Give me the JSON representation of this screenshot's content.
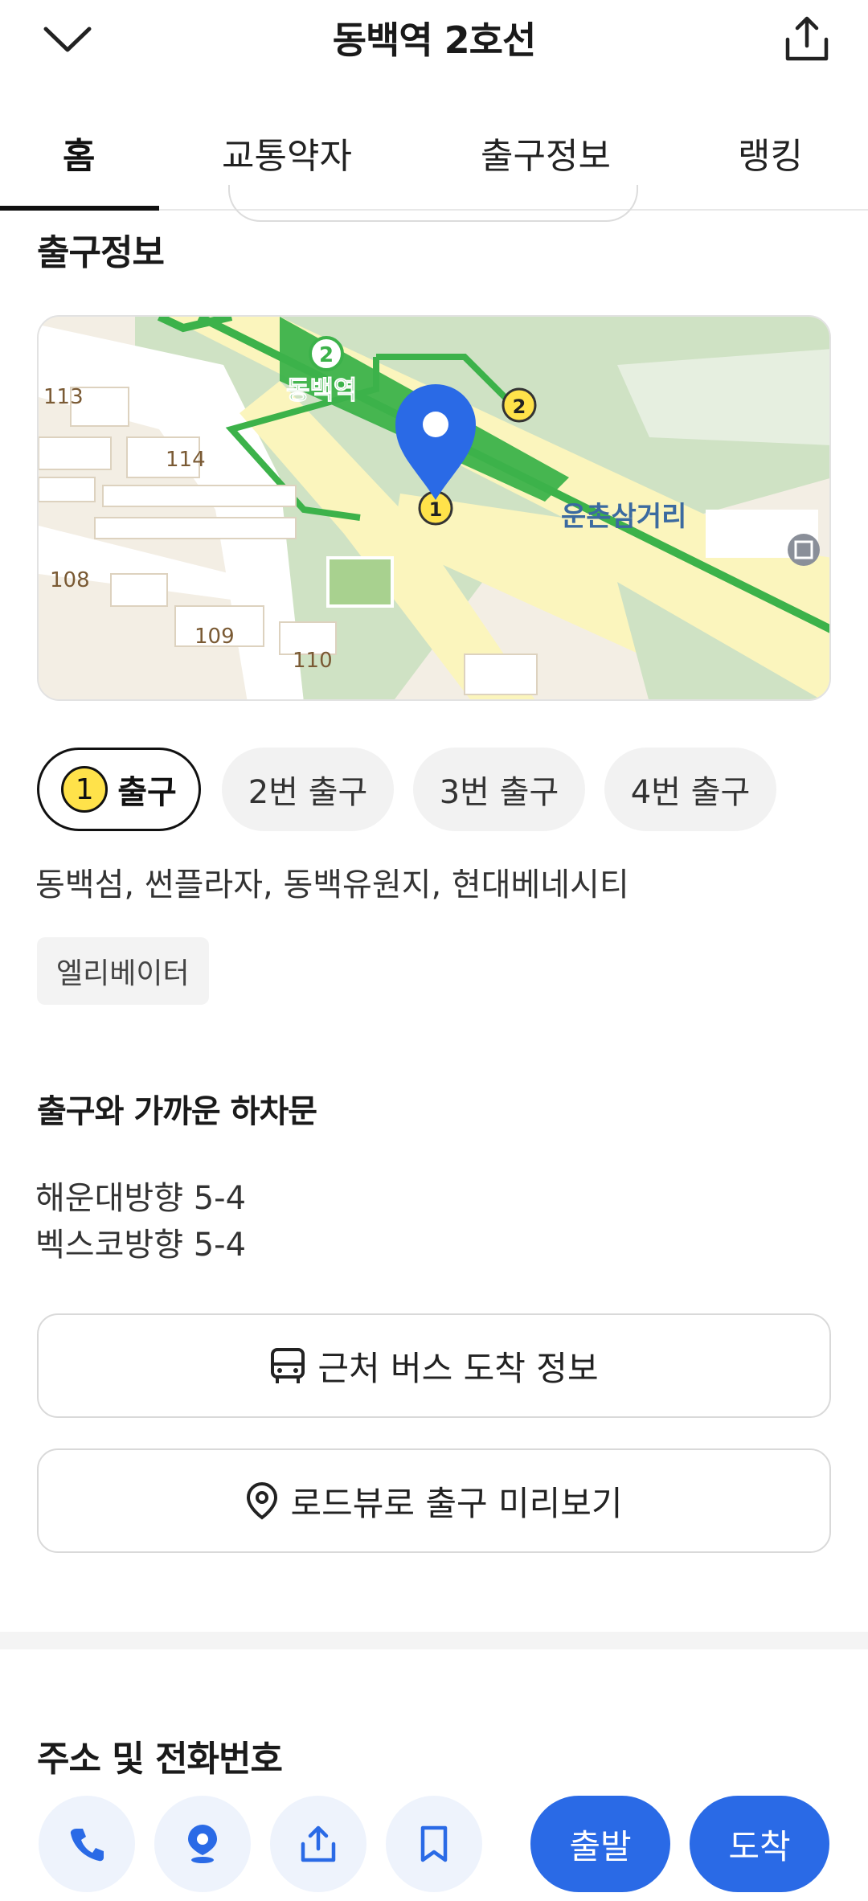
{
  "header": {
    "title": "동백역 2호선",
    "back_icon": "chevron-down-icon",
    "share_icon": "share-icon"
  },
  "tabs": [
    {
      "label": "홈",
      "active": true
    },
    {
      "label": "교통약자",
      "active": false
    },
    {
      "label": "출구정보",
      "active": false
    },
    {
      "label": "랭킹",
      "active": false
    }
  ],
  "exit_info": {
    "title": "출구정보",
    "map": {
      "station_label": "동백역",
      "line_number": "2",
      "intersection_label": "운촌삼거리",
      "exit_markers": [
        "1",
        "2"
      ],
      "block_numbers": [
        "113",
        "114",
        "108",
        "109",
        "110"
      ],
      "colors": {
        "line_green": "#3cb24a",
        "pin_blue": "#2a6ae6",
        "road_yellow": "#fbf5bd",
        "park_green": "#cfe2c4"
      }
    },
    "exits": [
      {
        "number": "1",
        "label": "출구",
        "active": true
      },
      {
        "label": "2번 출구",
        "active": false
      },
      {
        "label": "3번 출구",
        "active": false
      },
      {
        "label": "4번 출구",
        "active": false
      }
    ],
    "places": "동백섬, 썬플라자, 동백유원지, 현대베네시티",
    "facility_tag": "엘리베이터",
    "platform_title": "출구와 가까운 하차문",
    "platform_lines": [
      "해운대방향 5-4",
      "벡스코방향 5-4"
    ],
    "bus_button": "근처 버스 도착 정보",
    "roadview_button": "로드뷰로 출구 미리보기"
  },
  "address": {
    "title": "주소 및 전화번호"
  },
  "actions": {
    "icons": [
      "phone-icon",
      "location-pin-icon",
      "share-icon",
      "bookmark-icon"
    ],
    "depart": "출발",
    "arrive": "도착",
    "accent": "#2a6ae6"
  }
}
